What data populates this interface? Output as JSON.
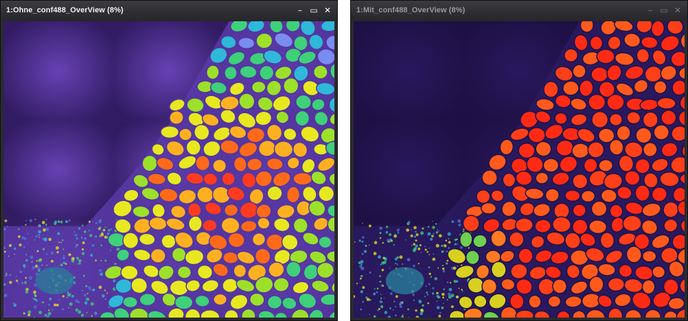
{
  "windows": [
    {
      "title": "1:Ohne_conf488_OverView (8%)",
      "controls": {
        "minimize": "–",
        "maximize": "▭",
        "close": "✕"
      },
      "image_name": "fluorescence-overview-without"
    },
    {
      "title": "1:Mit_conf488_OverView (8%)",
      "controls": {
        "minimize": "–",
        "maximize": "▭",
        "close": "✕"
      },
      "image_name": "fluorescence-overview-with"
    }
  ],
  "colors": {
    "frame": "#2a2a2e",
    "left_background": "#4a2a8c",
    "right_background": "#241452",
    "cell_palette_left": [
      "#ff3b1f",
      "#ff6a1a",
      "#ffb020",
      "#e8e820",
      "#9de02a",
      "#3fd07a",
      "#2fb8d8",
      "#7a8cf0"
    ],
    "cell_palette_right": [
      "#ff2a14",
      "#ff3f18",
      "#ff5a1c",
      "#ff7a20",
      "#d8d020",
      "#6fd050",
      "#2fa8c8"
    ]
  }
}
